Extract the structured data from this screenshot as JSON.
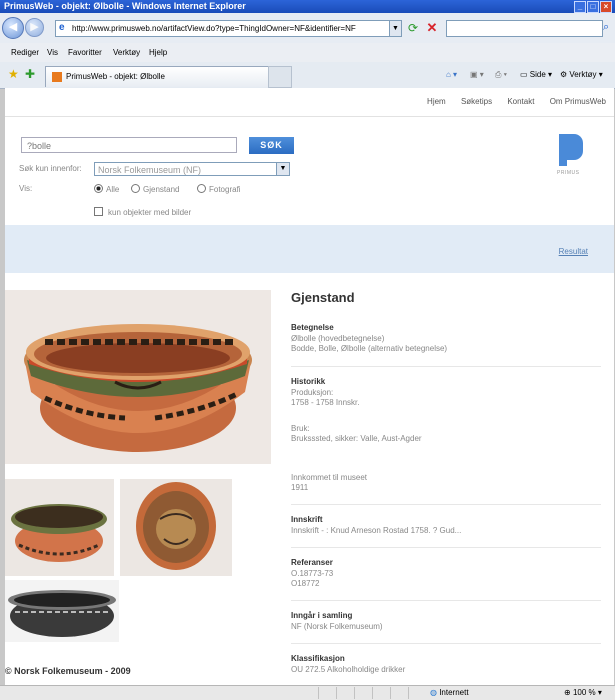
{
  "window": {
    "title": "PrimusWeb - objekt: Ølbolle - Windows Internet Explorer",
    "controls": [
      "_",
      "□",
      "×"
    ]
  },
  "address_bar": {
    "url": "http://www.primusweb.no/artifactView.do?type=ThingIdOwner=NF&identifier=NF",
    "search_value": ""
  },
  "menu": {
    "items": [
      "Rediger",
      "Vis",
      "Favoritter",
      "Verktøy",
      "Hjelp"
    ]
  },
  "tab": {
    "title": "PrimusWeb - objekt: Ølbolle"
  },
  "toolbar": {
    "side_label": "Side",
    "tools_label": "Verktøy"
  },
  "site": {
    "nav": [
      "Hjem",
      "Søketips",
      "Kontakt",
      "Om PrimusWeb"
    ],
    "search": {
      "query": "?bolle",
      "button_label": "SØK",
      "within_label": "Søk kun innenfor:",
      "within_value": "Norsk Folkemuseum (NF)",
      "vis_label": "Vis:",
      "radio_options": [
        {
          "label": "Alle",
          "selected": true
        },
        {
          "label": "Gjenstand",
          "selected": false
        },
        {
          "label": "Fotografi",
          "selected": false
        }
      ],
      "only_images_label": "kun objekter med bilder"
    },
    "logo_text": "PRIMUS",
    "resultat_link": "Resultat",
    "copyright": "© Norsk Folkemuseum - 2009"
  },
  "object": {
    "heading": "Gjenstand",
    "sections": [
      {
        "title": "Betegnelse",
        "lines": [
          "Ølbolle (hovedbetegnelse)",
          "Bodde, Bolle, Ølbolle (alternativ betegnelse)"
        ]
      },
      {
        "title": "Historikk",
        "lines": [
          "Produksjon:",
          "    1758 - 1758 Innskr.",
          "",
          "Bruk:",
          "    Bruksssted, sikker: Valle, Aust-Agder",
          "",
          "",
          "Innkommet til museet",
          "    1911"
        ]
      },
      {
        "title": "Innskrift",
        "lines": [
          "Innskrift - : Knud Arneson Rostad 1758. ? Gud..."
        ]
      },
      {
        "title": "Referanser",
        "lines": [
          "O.18773-73",
          "O18772"
        ]
      },
      {
        "title": "Inngår i samling",
        "lines": [
          "NF (Norsk Folkemuseum)"
        ]
      },
      {
        "title": "Klassifikasjon",
        "lines": [
          "OU 272.5 Alkoholholdige drikker"
        ]
      }
    ]
  },
  "statusbar": {
    "zone": "Internett",
    "zoom": "100 %"
  },
  "colors": {
    "titlebar": "#1f56c6",
    "search_button": "#2b6cc2",
    "band": "#e1ebf6",
    "bowl_orange": "#d2744a",
    "bowl_dark": "#3a2a20"
  }
}
